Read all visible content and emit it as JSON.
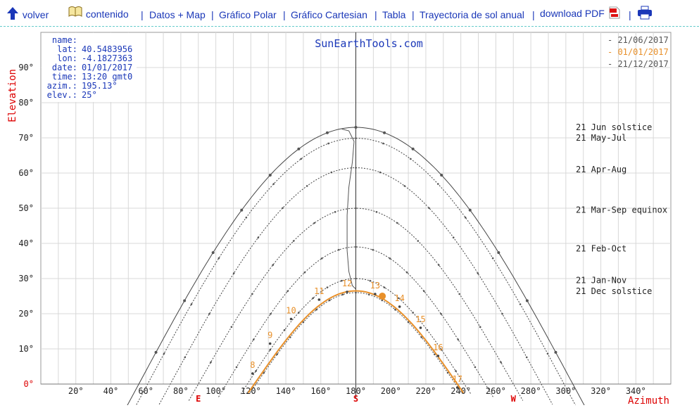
{
  "nav": {
    "back_label": "volver",
    "contents_label": "contenido",
    "links": [
      "Datos + Map",
      "Gráfico Polar",
      "Gráfico Cartesian",
      "Tabla",
      "Trayectoria de sol anual",
      "download PDF"
    ]
  },
  "colors": {
    "accent": "#e8902a",
    "link": "#1a37b8",
    "axis_label": "#dd0000",
    "title": "#1a37b8"
  },
  "chart_data": {
    "type": "line",
    "title": "SunEarthTools.com",
    "xlabel": "Azimuth",
    "ylabel": "Elevation",
    "xlim": [
      0,
      360
    ],
    "ylim": [
      0,
      100
    ],
    "xticks": [
      "20°",
      "40°",
      "60°",
      "80°",
      "100°",
      "120°",
      "140°",
      "160°",
      "180°",
      "200°",
      "220°",
      "240°",
      "260°",
      "280°",
      "300°",
      "320°",
      "340°"
    ],
    "yticks": [
      "0°",
      "10°",
      "20°",
      "30°",
      "40°",
      "50°",
      "60°",
      "70°",
      "80°",
      "90°"
    ],
    "compass": {
      "E": 90,
      "S": 180,
      "W": 270
    },
    "grid": true,
    "info": [
      {
        "k": "name:",
        "v": ""
      },
      {
        "k": "lat:",
        "v": "40.5483956"
      },
      {
        "k": "lon:",
        "v": "-4.1827363"
      },
      {
        "k": "date:",
        "v": "01/01/2017"
      },
      {
        "k": "time:",
        "v": "13:20 gmt0"
      },
      {
        "k": "azim.:",
        "v": "195.13°"
      },
      {
        "k": "elev.:",
        "v": "25°"
      }
    ],
    "legend": [
      {
        "label": "21/06/2017",
        "color": "#555555"
      },
      {
        "label": "01/01/2017",
        "color": "#e8902a"
      },
      {
        "label": "21/12/2017",
        "color": "#555555"
      }
    ],
    "series": [
      {
        "name": "21 Jun  solstice",
        "peak": 73,
        "half": 124,
        "style": "solid",
        "label_el": 73
      },
      {
        "name": "21 May-Jul",
        "peak": 69.9,
        "half": 119,
        "style": "dotted",
        "label_el": 70
      },
      {
        "name": "21 Apr-Aug",
        "peak": 61.5,
        "half": 106,
        "style": "dotted",
        "label_el": 61
      },
      {
        "name": "21 Mar-Sep equinox",
        "peak": 50,
        "half": 90,
        "style": "dotted",
        "label_el": 49.5
      },
      {
        "name": "21 Feb-Oct",
        "peak": 39,
        "half": 74,
        "style": "dotted",
        "label_el": 38.5
      },
      {
        "name": "21 Jan-Nov",
        "peak": 30,
        "half": 62,
        "style": "dotted",
        "label_el": 29.5
      },
      {
        "name": "21 Dec  solstice",
        "peak": 26,
        "half": 57,
        "style": "dotted",
        "label_el": 26.4
      }
    ],
    "current_day": {
      "peak": 26.5,
      "half": 58,
      "hour_points": [
        {
          "h": "8",
          "az": 121,
          "el": 3
        },
        {
          "h": "9",
          "az": 131,
          "el": 11.5
        },
        {
          "h": "10",
          "az": 143,
          "el": 18.5
        },
        {
          "h": "11",
          "az": 159,
          "el": 24
        },
        {
          "h": "12",
          "az": 175,
          "el": 26.2
        },
        {
          "h": "13",
          "az": 191,
          "el": 25.6
        },
        {
          "h": "14",
          "az": 205,
          "el": 22
        },
        {
          "h": "15",
          "az": 217,
          "el": 16
        },
        {
          "h": "16",
          "az": 227,
          "el": 8
        },
        {
          "h": "17",
          "az": 238,
          "el": -1
        }
      ],
      "sun": {
        "az": 195.13,
        "el": 25
      }
    },
    "analemma": [
      [
        172,
        72.5
      ],
      [
        176,
        72
      ],
      [
        179,
        69
      ],
      [
        178,
        63
      ],
      [
        176,
        56
      ],
      [
        175,
        48
      ],
      [
        175,
        38
      ],
      [
        176,
        32
      ],
      [
        178,
        28
      ],
      [
        180,
        27
      ]
    ]
  }
}
